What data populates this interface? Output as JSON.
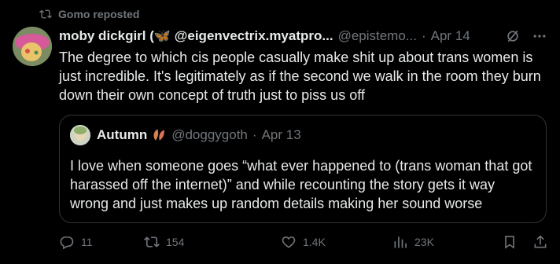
{
  "repost": {
    "label": "Gomo reposted",
    "icon": "repost-icon"
  },
  "post": {
    "display_name": "moby dickgirl (🦋 @eigenvectrix.myatpro...",
    "handle": "@epistemo...",
    "separator": "·",
    "date": "Apr 14",
    "text": "The degree to which cis people casually make shit up about trans women is just incredible. It's legitimately as if the second we walk in the room they burn down their own concept of truth just to piss us off",
    "header_icons": [
      "grok-icon",
      "more-icon"
    ]
  },
  "quote": {
    "display_name": "Autumn",
    "handle": "@doggygoth",
    "separator": "·",
    "date": "Apr 13",
    "text": "I love when someone goes “what ever happened to (trans woman that got harassed off the internet)” and while recounting the story gets it way wrong and just makes up random details making her sound worse"
  },
  "actions": {
    "replies": "11",
    "reposts": "154",
    "likes": "1.4K",
    "views": "23K"
  },
  "colors": {
    "background": "#000000",
    "text": "#e7e9ea",
    "muted": "#71767b",
    "border": "#2f3336"
  }
}
